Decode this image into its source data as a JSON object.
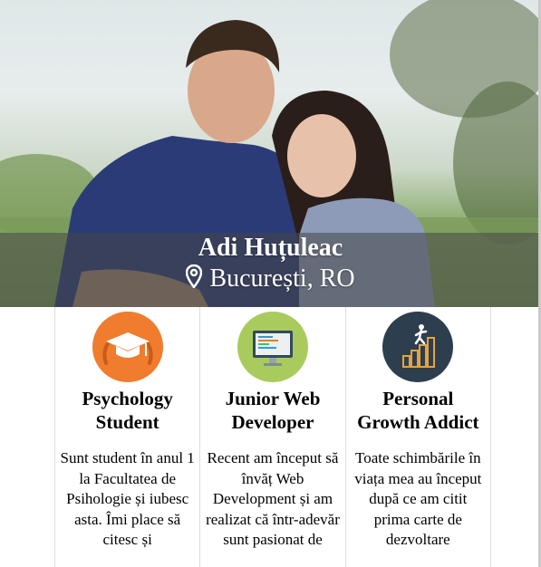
{
  "profile": {
    "name": "Adi Huțuleac",
    "location": "București, RO"
  },
  "cards": [
    {
      "title": "Psychology Student",
      "text": "Sunt student în anul 1 la Facultatea de Psihologie și iubesc asta. Îmi place să citesc și",
      "icon": "graduation-cap-icon",
      "color": "#f07c2e"
    },
    {
      "title": "Junior Web Developer",
      "text": "Recent am început să învăț Web Development și am realizat că într-adevăr sunt pasionat de",
      "icon": "monitor-code-icon",
      "color": "#a9cb5d"
    },
    {
      "title": "Personal Growth Addict",
      "text": "Toate schimbările în viața mea au început după ce am citit prima carte de dezvoltare",
      "icon": "growth-chart-icon",
      "color": "#2d3e4f"
    }
  ]
}
